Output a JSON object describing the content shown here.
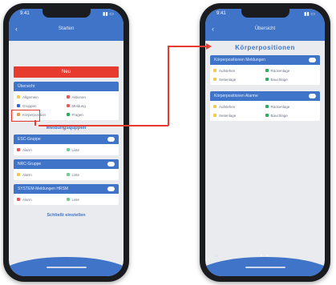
{
  "phone_left": {
    "status": {
      "time": "9:41",
      "battery": "▮▮ ▭"
    },
    "appbar": {
      "back": "‹",
      "title": "Starten"
    },
    "action_button": "Neu",
    "card1": {
      "header": "Übersicht",
      "items": [
        {
          "label": "Allgemein",
          "color": "#f2c94c"
        },
        {
          "label": "Aktionen",
          "color": "#eb5757"
        },
        {
          "label": "Gruppen",
          "color": "#2e6ad1"
        },
        {
          "label": "Meldung",
          "color": "#eb5757"
        },
        {
          "label": "Körperposition",
          "color": "#f2994a"
        },
        {
          "label": "Fragen",
          "color": "#27ae60"
        }
      ]
    },
    "subheading": "Meldungsquppen",
    "card2": {
      "header": "ESC-Gruppe",
      "items": [
        {
          "label": "Alarm",
          "color": "#eb5757"
        },
        {
          "label": "Liste",
          "color": "#6fcf97"
        }
      ]
    },
    "card3": {
      "header": "NRC-Gruppe",
      "items": [
        {
          "label": "Alarm",
          "color": "#f2c94c"
        },
        {
          "label": "Liste",
          "color": "#6fcf97"
        }
      ]
    },
    "card4": {
      "header": "SYSTEM-Meldungen HRSM",
      "items": [
        {
          "label": "Alarm",
          "color": "#eb5757"
        },
        {
          "label": "Liste",
          "color": "#6fcf97"
        }
      ]
    },
    "footer_button": "Schließt einstellen"
  },
  "phone_right": {
    "status": {
      "time": "9:41",
      "battery": "▮▮ ▭"
    },
    "appbar": {
      "back": "‹",
      "title": "Übersicht"
    },
    "big_title": "Körperpositionen",
    "card1": {
      "header": "Körperpositionen Meldungen",
      "items": [
        {
          "label": "Aufstehen",
          "color": "#f2c94c"
        },
        {
          "label": "Rückenlage",
          "color": "#27ae60"
        },
        {
          "label": "Seitenlage",
          "color": "#f2c94c"
        },
        {
          "label": "Bauchlage",
          "color": "#27ae60"
        }
      ]
    },
    "card2": {
      "header": "Körperpositionen Alarme",
      "items": [
        {
          "label": "Aufstehen",
          "color": "#f2c94c"
        },
        {
          "label": "Rückenlage",
          "color": "#27ae60"
        },
        {
          "label": "Seitenlage",
          "color": "#f2c94c"
        },
        {
          "label": "Bauchlage",
          "color": "#27ae60"
        }
      ]
    },
    "pager": "• •",
    "corner": "⌂"
  },
  "colors": {
    "accent": "#3f74c8",
    "danger": "#e63b2e",
    "screen_bg": "#e9ebef"
  }
}
